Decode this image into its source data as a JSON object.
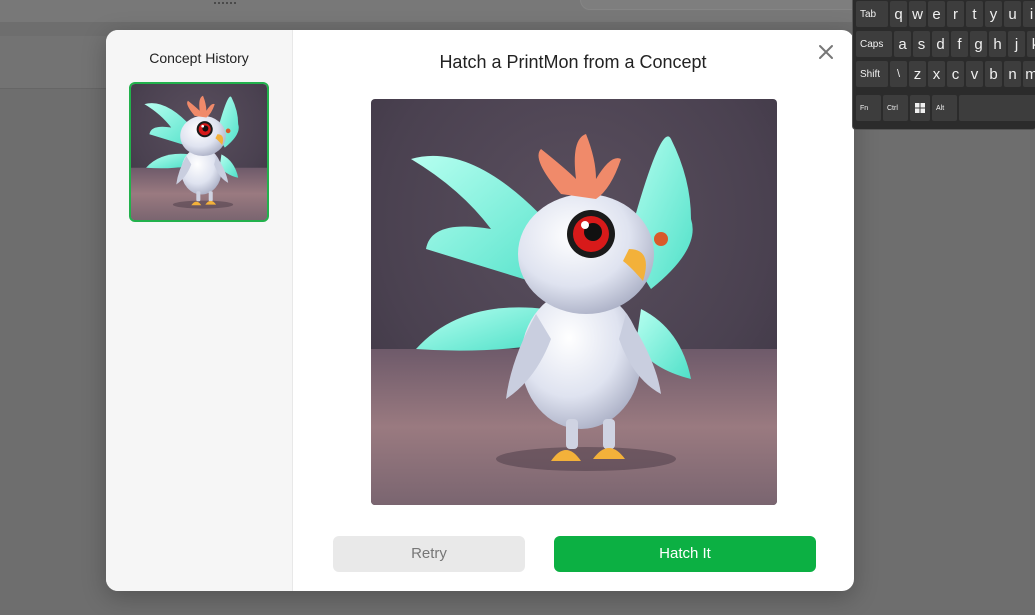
{
  "modal": {
    "title": "Hatch a PrintMon from a Concept",
    "history_title": "Concept History",
    "buttons": {
      "retry": "Retry",
      "hatch": "Hatch It"
    },
    "close_icon": "close-icon"
  },
  "colors": {
    "accent_green": "#0cb043",
    "thumb_border": "#22b14c",
    "retry_bg": "#e9e9e9"
  },
  "keyboard": {
    "row1": [
      "Tab",
      "q",
      "w",
      "e",
      "r",
      "t",
      "y",
      "u",
      "i"
    ],
    "row2": [
      "Caps",
      "a",
      "s",
      "d",
      "f",
      "g",
      "h",
      "j",
      "k"
    ],
    "row3": [
      "Shift",
      "\\",
      "z",
      "x",
      "c",
      "v",
      "b",
      "n",
      "m"
    ],
    "row4": [
      "Fn",
      "Ctrl",
      "windows-icon",
      "Alt",
      ""
    ]
  }
}
